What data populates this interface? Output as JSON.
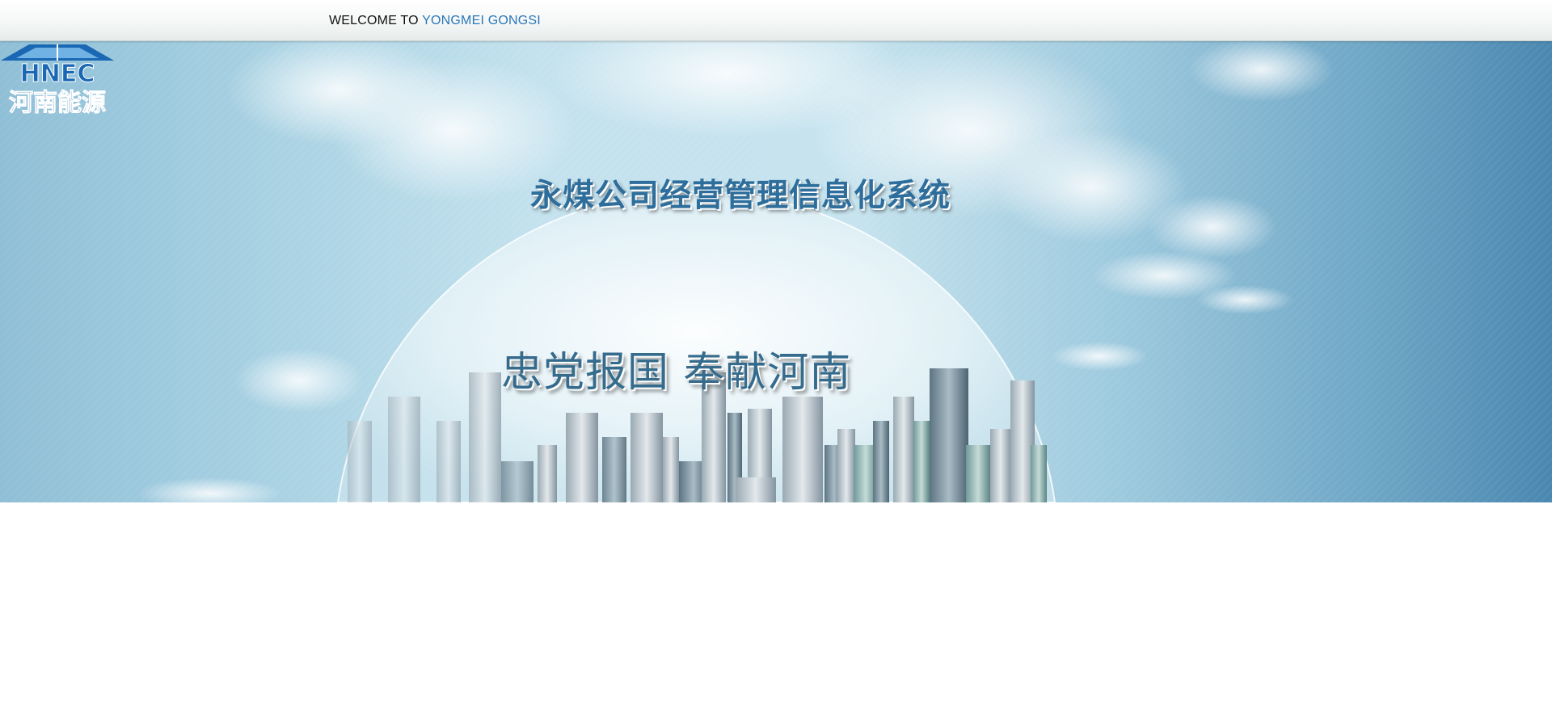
{
  "header": {
    "welcome_prefix": "WELCOME TO",
    "welcome_brand": "YONGMEI GONGSI"
  },
  "banner": {
    "logo": {
      "abbr": "HNEC",
      "name": "河南能源"
    },
    "system_title": "永煤公司经营管理信息化系统",
    "slogan": "忠党报国 奉献河南"
  },
  "colors": {
    "brand_blue": "#2a77b8",
    "title_blue": "#2d6e9c",
    "sky_right": "#4a87b0",
    "logo_blue": "#1a67b3"
  }
}
